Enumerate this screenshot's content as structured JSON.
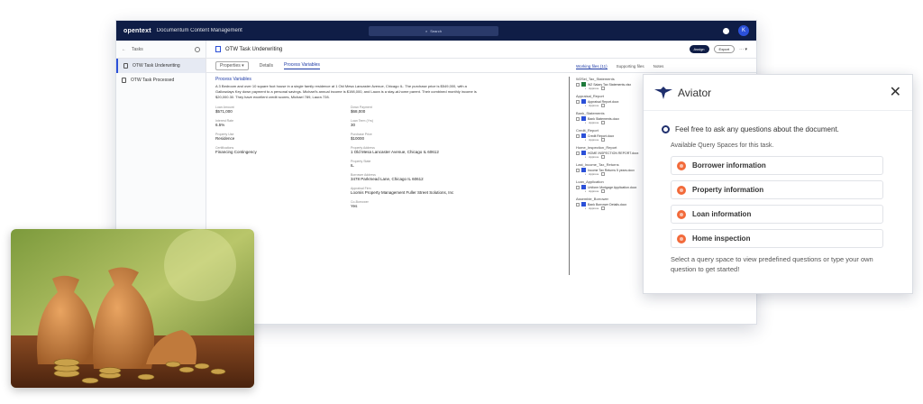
{
  "topbar": {
    "brand": "opentext",
    "app_title": "Documentum Content Management",
    "search": "Search",
    "user_initial": "K"
  },
  "sidebar": {
    "back_label": "Tasks",
    "items": [
      {
        "label": "OTW Task Underwriting"
      },
      {
        "label": "OTW Task Processed"
      }
    ]
  },
  "doc": {
    "title": "OTW Task Underwriting",
    "assign_label": "Assign",
    "export_label": "Export",
    "tabs": {
      "properties": "Properties",
      "details": "Details",
      "process_variables": "Process Variables"
    }
  },
  "content": {
    "section_title": "Process Variables",
    "paragraph": "A 3 Bedroom and over 10 square foot house in a single family residence at 1 Old Mesa Lancaster Avenue, Chicago IL. The purchase price is $549,000, with a Gallowdays Key down payment to a personal savings. Michael's annual income is $198,000, and Laura is a stay-at-home parent. Their combined monthly income is $20,000.30. They have excellent credit scores, Michael 789, Laura 728.",
    "fields": [
      {
        "label": "Loan Amount",
        "value": "$571,000"
      },
      {
        "label": "Down Payment",
        "value": "$68,000"
      },
      {
        "label": "Interest Rate",
        "value": "6.5%"
      },
      {
        "label": "Loan Term (Yrs)",
        "value": "30"
      },
      {
        "label": "Property Use",
        "value": "Residence"
      },
      {
        "label": "Purchase Price",
        "value": "$10000"
      },
      {
        "label": "Certifications",
        "value": "Financing Contingency"
      },
      {
        "label": "Property Address",
        "value": "1 Old Mesa Lancaster Avenue, Chicago IL 60612"
      },
      {
        "label": "",
        "value": ""
      },
      {
        "label": "Property State",
        "value": "IL"
      },
      {
        "label": "",
        "value": ""
      },
      {
        "label": "Borrower Address",
        "value": "3478 Parkmead Lane, Chicago IL 60612"
      },
      {
        "label": "",
        "value": ""
      },
      {
        "label": "Appraisal Firm",
        "value": "Loomis Property Management Fuller Street Solutions, Inc"
      },
      {
        "label": "",
        "value": ""
      },
      {
        "label": "Co-Borrower",
        "value": "Yes"
      }
    ]
  },
  "right": {
    "tabs": {
      "working_files": "Working files (11)",
      "supporting_files": "Supporting files",
      "notes": "Notes"
    },
    "groups": [
      {
        "name": "W2Sel_Tax_Statements",
        "file": "W2 Salary Tax Statements.xlsx",
        "type": "xl"
      },
      {
        "name": "Appraisal_Report",
        "file": "Appraisal Report.docx",
        "type": "pdf"
      },
      {
        "name": "Bank_Statements",
        "file": "Bank Statements.docx",
        "type": "pdf"
      },
      {
        "name": "Credit_Report",
        "file": "Credit Report.docx",
        "type": "pdf"
      },
      {
        "name": "Home_Inspection_Report",
        "file": "HOME INSPECTION REPORT.docx",
        "type": "pdf"
      },
      {
        "name": "Last_Income_Tax_Returns",
        "file": "Income Tax Returns 5 years.docx",
        "type": "pdf"
      },
      {
        "name": "Loan_Application",
        "file": "Uniform Mortgage Application.docx",
        "type": "pdf"
      },
      {
        "name": "Assemble_Borrower",
        "file": "Bank Borrower Details.docx",
        "type": "pdf"
      }
    ],
    "meta_label": "Approve"
  },
  "aviator": {
    "title": "Aviator",
    "intro": "Feel free to ask any questions about the document.",
    "subtitle": "Available Query Spaces for this task.",
    "spaces": [
      "Borrower information",
      "Property information",
      "Loan information",
      "Home inspection"
    ],
    "footer": "Select a query space to view predefined questions or type your own question to get started!"
  },
  "colors": {
    "navy": "#0f1d46",
    "accent": "#2b50d8",
    "query_dot": "#f26a3a"
  }
}
